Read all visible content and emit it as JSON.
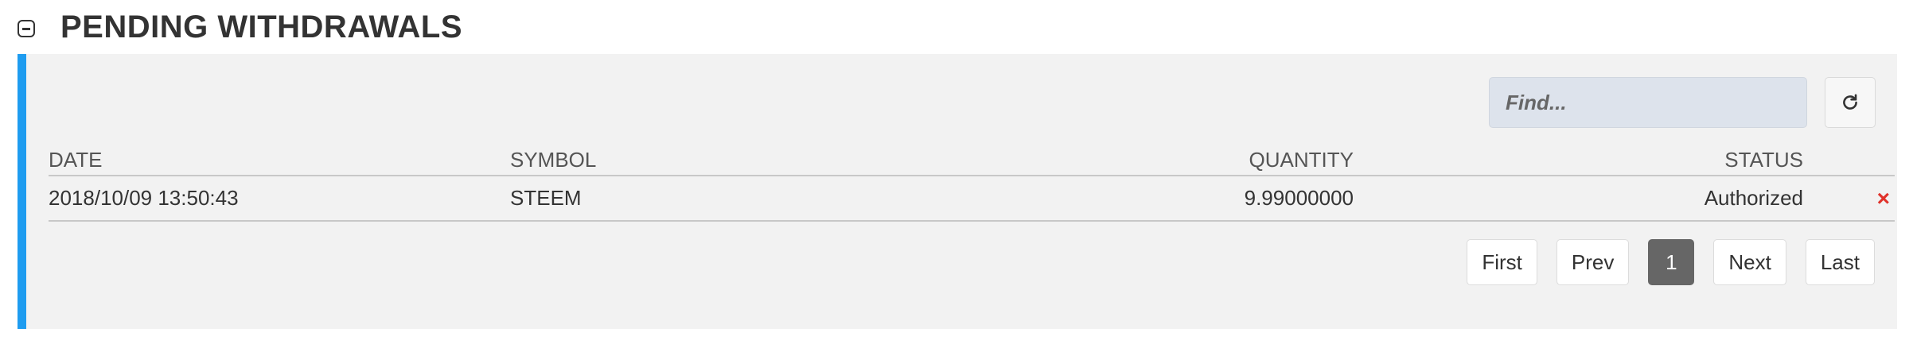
{
  "section": {
    "title": "PENDING WITHDRAWALS",
    "accent_color": "#1e9cf0"
  },
  "search": {
    "placeholder": "Find..."
  },
  "table": {
    "headers": {
      "date": "DATE",
      "symbol": "SYMBOL",
      "quantity": "QUANTITY",
      "status": "STATUS"
    },
    "rows": [
      {
        "date": "2018/10/09 13:50:43",
        "symbol": "STEEM",
        "quantity": "9.99000000",
        "status": "Authorized",
        "cancel": "×"
      }
    ]
  },
  "pagination": {
    "first": "First",
    "prev": "Prev",
    "current": "1",
    "next": "Next",
    "last": "Last"
  },
  "icons": {
    "collapse": "minus-square-icon",
    "refresh": "refresh-icon",
    "cancel": "close-icon"
  }
}
